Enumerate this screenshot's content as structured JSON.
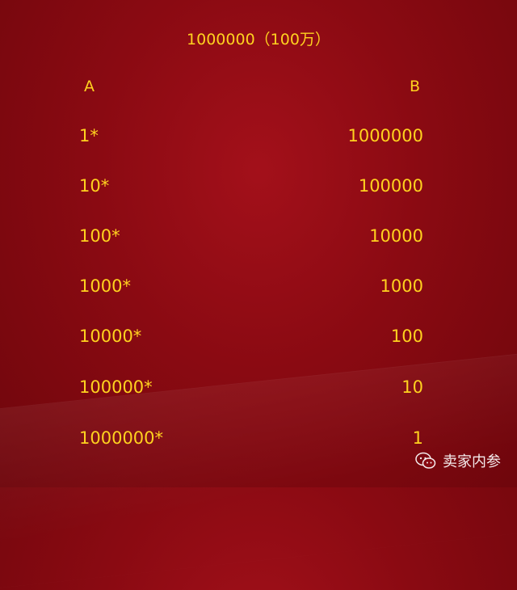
{
  "title": "1000000（100万）",
  "headers": {
    "a": "A",
    "b": "B"
  },
  "rows": [
    {
      "a": "1*",
      "b": "1000000"
    },
    {
      "a": "10*",
      "b": "100000"
    },
    {
      "a": "100*",
      "b": "10000"
    },
    {
      "a": "1000*",
      "b": "1000"
    },
    {
      "a": "10000*",
      "b": "100"
    },
    {
      "a": "100000*",
      "b": "10"
    },
    {
      "a": "1000000*",
      "b": "1"
    }
  ],
  "watermark": {
    "text": "卖家内参",
    "icon": "wechat-icon"
  },
  "colors": {
    "background": "#8a0a12",
    "text": "#ffd21f"
  }
}
